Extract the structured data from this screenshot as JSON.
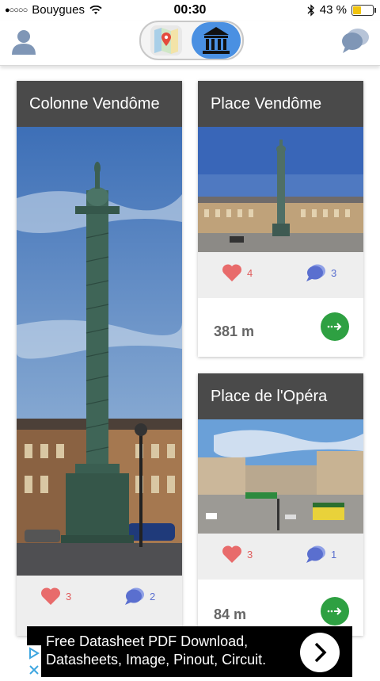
{
  "status_bar": {
    "signal": "●○○○○",
    "carrier": "Bouygues",
    "time": "00:30",
    "battery": "43 %",
    "battery_fraction": 0.43
  },
  "toggle": {
    "options": [
      "map",
      "monuments"
    ],
    "selected": "monuments"
  },
  "cards": [
    {
      "title": "Colonne Vendôme",
      "likes": "3",
      "comments": "2"
    },
    {
      "title": "Place Vendôme",
      "likes": "4",
      "comments": "3",
      "distance": "381 m"
    },
    {
      "title": "Place de l'Opéra",
      "likes": "3",
      "comments": "1",
      "distance": "84 m"
    }
  ],
  "ad": {
    "line1": "Free Datasheet PDF Download,",
    "line2": "Datasheets, Image, Pinout, Circuit."
  },
  "colors": {
    "title_bar": "#4a4a4a",
    "like": "#e05d5d",
    "comment": "#5a6fcf",
    "go": "#2ea042",
    "toggle_active": "#4a90e2"
  }
}
